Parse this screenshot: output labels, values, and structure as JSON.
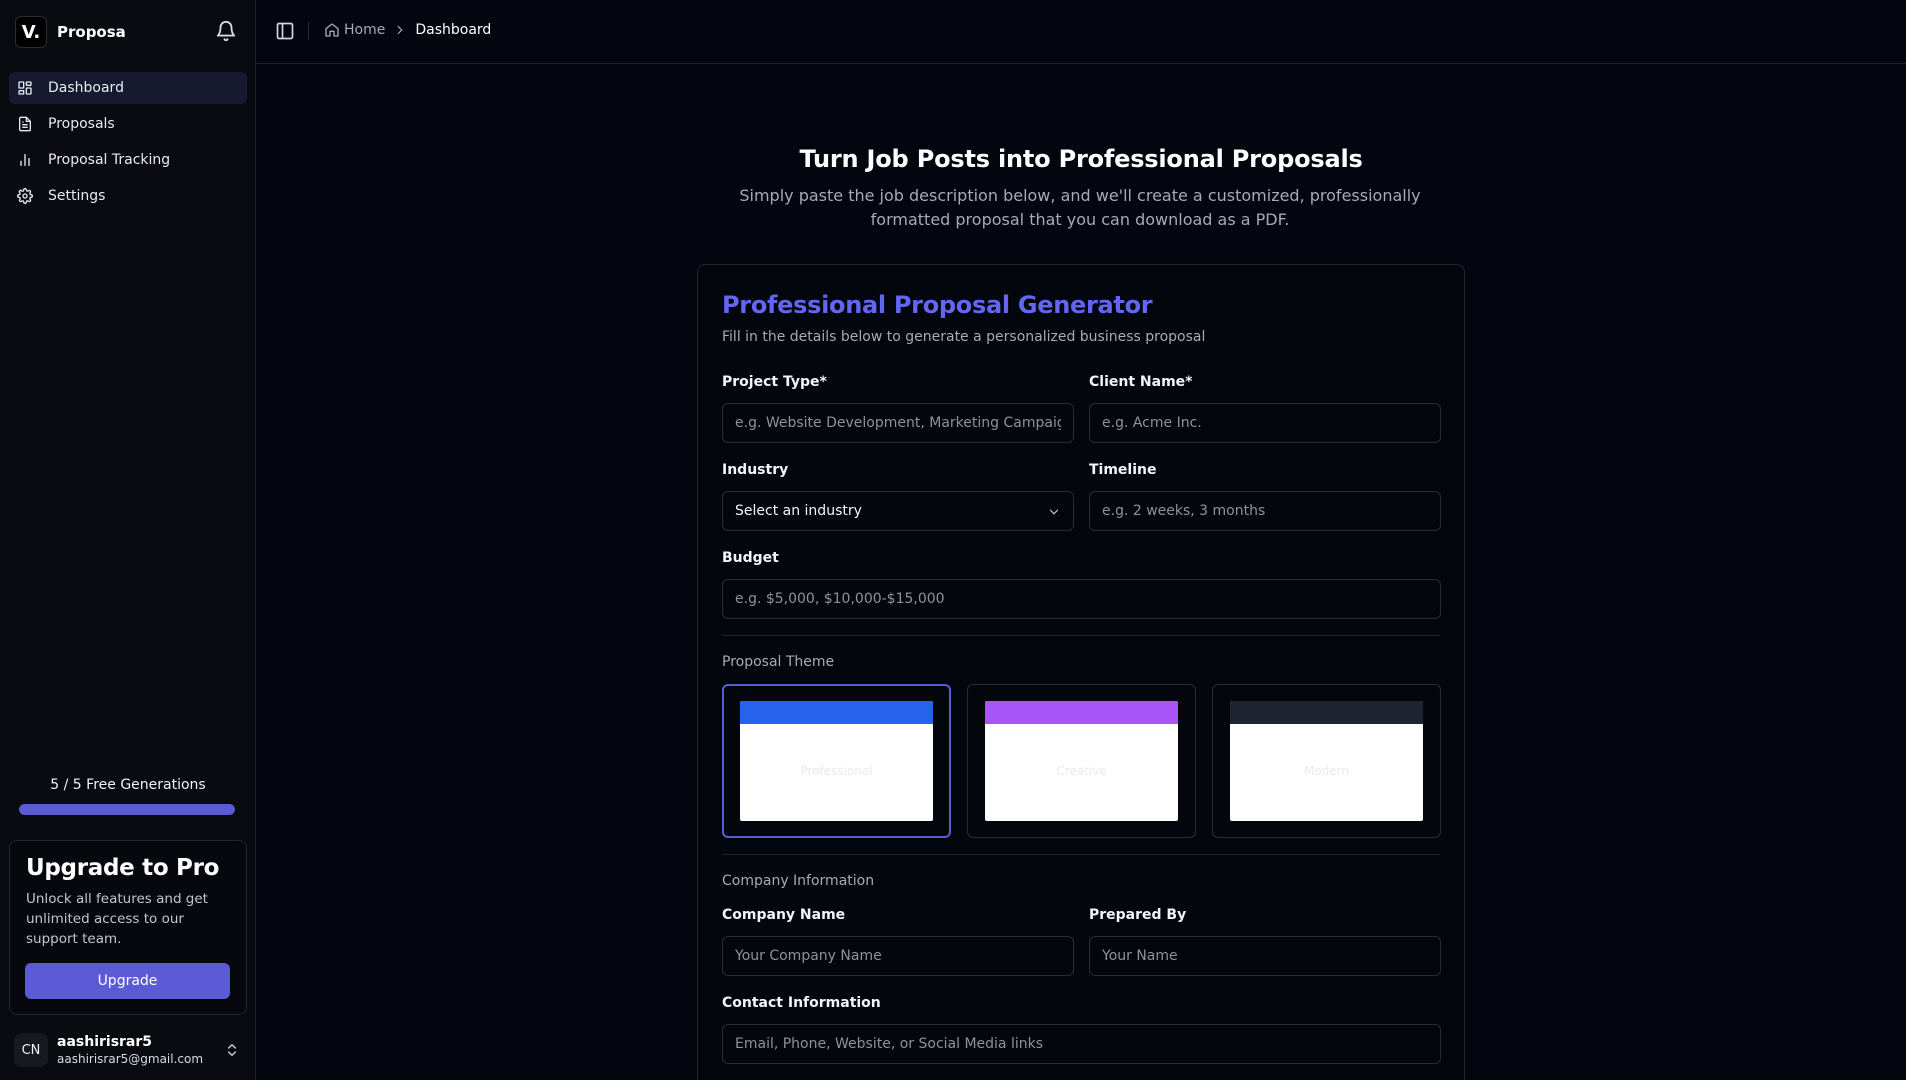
{
  "app": {
    "name": "Proposa",
    "logo_text": "V."
  },
  "nav": {
    "items": [
      {
        "label": "Dashboard",
        "icon": "grid-icon",
        "active": true
      },
      {
        "label": "Proposals",
        "icon": "file-icon",
        "active": false
      },
      {
        "label": "Proposal Tracking",
        "icon": "bar-chart-icon",
        "active": false
      },
      {
        "label": "Settings",
        "icon": "gear-icon",
        "active": false
      }
    ]
  },
  "usage": {
    "label": "5 / 5 Free Generations",
    "fraction": 1.0
  },
  "upgrade": {
    "title": "Upgrade to Pro",
    "description": "Unlock all features and get unlimited access to our support team.",
    "button": "Upgrade"
  },
  "user": {
    "initials": "CN",
    "name": "aashirisrar5",
    "email": "aashirisrar5@gmail.com"
  },
  "breadcrumb": {
    "home": "Home",
    "current": "Dashboard"
  },
  "hero": {
    "title": "Turn Job Posts into Professional Proposals",
    "subtitle": "Simply paste the job description below, and we'll create a customized, professionally formatted proposal that you can download as a PDF."
  },
  "form": {
    "title": "Professional Proposal Generator",
    "subtitle": "Fill in the details below to generate a personalized business proposal",
    "project_type": {
      "label": "Project Type*",
      "placeholder": "e.g. Website Development, Marketing Campaign",
      "value": ""
    },
    "client_name": {
      "label": "Client Name*",
      "placeholder": "e.g. Acme Inc.",
      "value": ""
    },
    "industry": {
      "label": "Industry",
      "selected": "Select an industry"
    },
    "timeline": {
      "label": "Timeline",
      "placeholder": "e.g. 2 weeks, 3 months",
      "value": ""
    },
    "budget": {
      "label": "Budget",
      "placeholder": "e.g. $5,000, $10,000-$15,000",
      "value": ""
    },
    "theme_section": "Proposal Theme",
    "themes": [
      {
        "name": "Professional",
        "color": "#2563eb",
        "selected": true
      },
      {
        "name": "Creative",
        "color": "#a855f7",
        "selected": false
      },
      {
        "name": "Modern",
        "color": "#1e2530",
        "selected": false
      }
    ],
    "company_section": "Company Information",
    "company_name": {
      "label": "Company Name",
      "placeholder": "Your Company Name",
      "value": ""
    },
    "prepared_by": {
      "label": "Prepared By",
      "placeholder": "Your Name",
      "value": ""
    },
    "contact_info": {
      "label": "Contact Information",
      "placeholder": "Email, Phone, Website, or Social Media links",
      "value": ""
    }
  },
  "colors": {
    "accent": "#5b5bd6",
    "title_accent": "#6366f1",
    "background": "#03050f",
    "sidebar": "#0a0b10"
  }
}
